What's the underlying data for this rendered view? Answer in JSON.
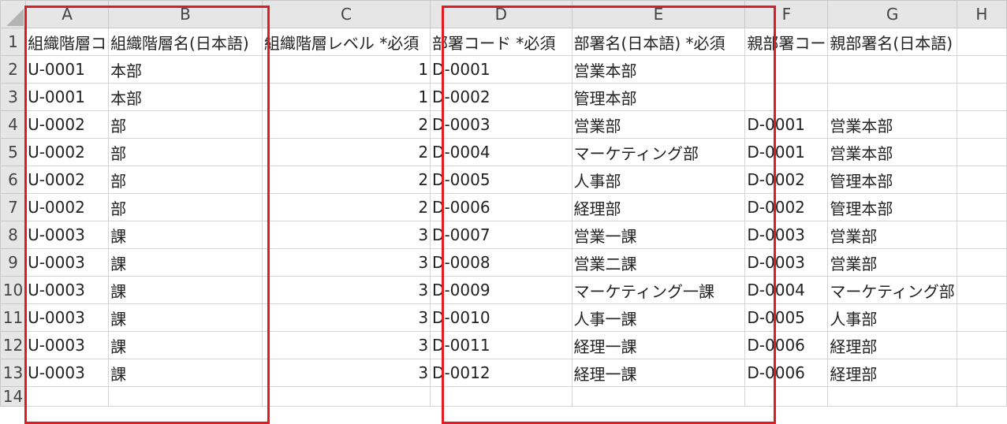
{
  "columns": [
    "A",
    "B",
    "C",
    "D",
    "E",
    "F",
    "G",
    "H"
  ],
  "rows": [
    {
      "n": "1",
      "cells": [
        "組織階層コ",
        "組織階層名(日本語)",
        "組織階層レベル *必須",
        "部署コード *必須",
        "部署名(日本語) *必須",
        "親部署コー",
        "親部署名(日本語)",
        ""
      ]
    },
    {
      "n": "2",
      "cells": [
        "U-0001",
        "本部",
        "1",
        "D-0001",
        "営業本部",
        "",
        "",
        ""
      ]
    },
    {
      "n": "3",
      "cells": [
        "U-0001",
        "本部",
        "1",
        "D-0002",
        "管理本部",
        "",
        "",
        ""
      ]
    },
    {
      "n": "4",
      "cells": [
        "U-0002",
        "部",
        "2",
        "D-0003",
        "営業部",
        "D-0001",
        "営業本部",
        ""
      ]
    },
    {
      "n": "5",
      "cells": [
        "U-0002",
        "部",
        "2",
        "D-0004",
        "マーケティング部",
        "D-0001",
        "営業本部",
        ""
      ]
    },
    {
      "n": "6",
      "cells": [
        "U-0002",
        "部",
        "2",
        "D-0005",
        "人事部",
        "D-0002",
        "管理本部",
        ""
      ]
    },
    {
      "n": "7",
      "cells": [
        "U-0002",
        "部",
        "2",
        "D-0006",
        "経理部",
        "D-0002",
        "管理本部",
        ""
      ]
    },
    {
      "n": "8",
      "cells": [
        "U-0003",
        "課",
        "3",
        "D-0007",
        "営業一課",
        "D-0003",
        "営業部",
        ""
      ]
    },
    {
      "n": "9",
      "cells": [
        "U-0003",
        "課",
        "3",
        "D-0008",
        "営業二課",
        "D-0003",
        "営業部",
        ""
      ]
    },
    {
      "n": "10",
      "cells": [
        "U-0003",
        "課",
        "3",
        "D-0009",
        "マーケティング一課",
        "D-0004",
        "マーケティング部",
        ""
      ]
    },
    {
      "n": "11",
      "cells": [
        "U-0003",
        "課",
        "3",
        "D-0010",
        "人事一課",
        "D-0005",
        "人事部",
        ""
      ]
    },
    {
      "n": "12",
      "cells": [
        "U-0003",
        "課",
        "3",
        "D-0011",
        "経理一課",
        "D-0006",
        "経理部",
        ""
      ]
    },
    {
      "n": "13",
      "cells": [
        "U-0003",
        "課",
        "3",
        "D-0012",
        "経理一課",
        "D-0006",
        "経理部",
        ""
      ]
    },
    {
      "n": "14",
      "cells": [
        "",
        "",
        "",
        "",
        "",
        "",
        "",
        ""
      ]
    }
  ],
  "highlight_color": "#e21b23"
}
